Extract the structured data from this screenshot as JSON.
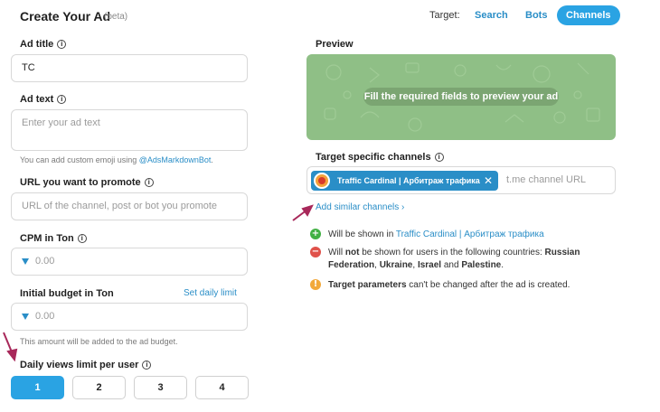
{
  "header": {
    "title": "Create Your Ad",
    "beta": "(beta)",
    "target_label": "Target:",
    "tabs": [
      {
        "label": "Search",
        "active": false
      },
      {
        "label": "Bots",
        "active": false
      },
      {
        "label": "Channels",
        "active": true
      }
    ]
  },
  "form": {
    "ad_title": {
      "label": "Ad title",
      "value": "TC"
    },
    "ad_text": {
      "label": "Ad text",
      "placeholder": "Enter your ad text",
      "hint_prefix": "You can add custom emoji using ",
      "hint_link": "@AdsMarkdownBot",
      "hint_suffix": "."
    },
    "url": {
      "label": "URL you want to promote",
      "placeholder": "URL of the channel, post or bot you promote"
    },
    "cpm": {
      "label": "CPM in Ton",
      "placeholder": "0.00"
    },
    "budget": {
      "label": "Initial budget in Ton",
      "link": "Set daily limit",
      "placeholder": "0.00",
      "hint": "This amount will be added to the ad budget."
    },
    "daily_views": {
      "label": "Daily views limit per user",
      "options": [
        "1",
        "2",
        "3",
        "4"
      ],
      "selected": "1"
    }
  },
  "preview": {
    "label": "Preview",
    "message": "Fill the required fields to preview your ad"
  },
  "channels": {
    "label": "Target specific channels",
    "chip": "Traffic Cardinal | Арбитраж трафика",
    "input_placeholder": "t.me channel URL",
    "add_similar": "Add similar channels ›"
  },
  "notes": {
    "shown_prefix": "Will be shown in ",
    "shown_channel": "Traffic Cardinal | Арбитраж трафика",
    "not_shown_1": "Will ",
    "not_shown_bold": "not",
    "not_shown_2": " be shown for users in the following countries: ",
    "country_russia": "Russian Federation",
    "sep1": ", ",
    "country_ukraine": "Ukraine",
    "sep2": ", ",
    "country_israel": "Israel",
    "and": " and ",
    "country_palestine": "Palestine",
    "end": ".",
    "params_bold": "Target parameters",
    "params_rest": " can't be changed after the ad is created."
  },
  "colors": {
    "accent": "#2aa3e3",
    "link": "#2a8ec7",
    "preview_bg": "#8fbf86",
    "annotation_arrow": "#a8285a"
  }
}
